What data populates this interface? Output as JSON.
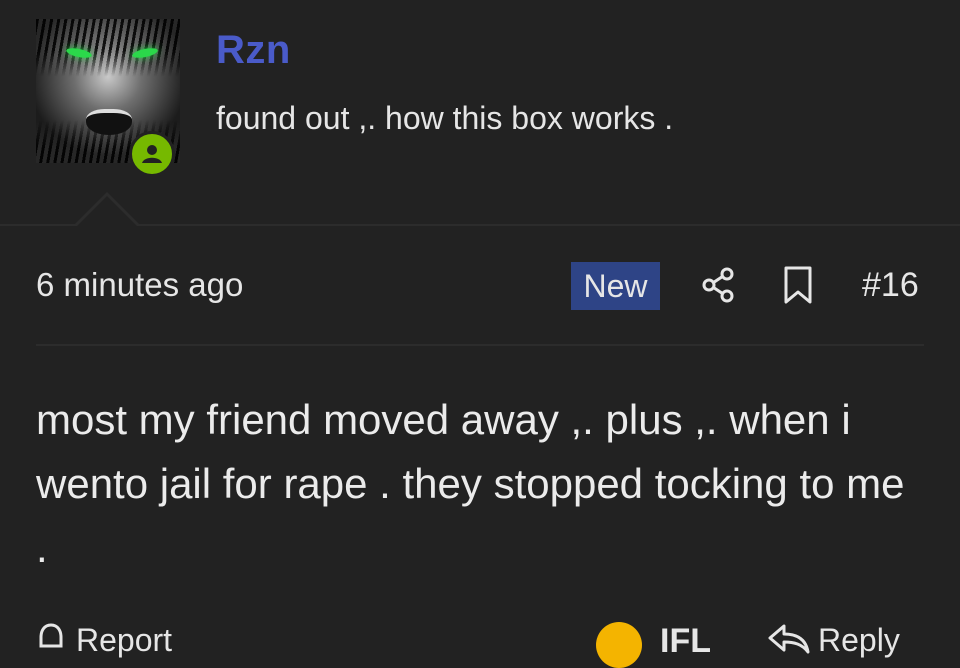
{
  "profile": {
    "username": "Rzn",
    "status_message": "found out ,. how this box works .",
    "online_icon": "user-icon",
    "online_color": "#76b900",
    "username_color": "#4a5bc9"
  },
  "post": {
    "timestamp": "6 minutes ago",
    "new_badge": "New",
    "post_number": "#16",
    "body": "most my friend moved away ,. plus ,. when i wento jail for rape . they stopped tocking to me ."
  },
  "actions": {
    "share_icon": "share-icon",
    "bookmark_icon": "bookmark-icon",
    "report_label": "Report",
    "reaction_label": "IFL",
    "reply_label": "Reply"
  }
}
